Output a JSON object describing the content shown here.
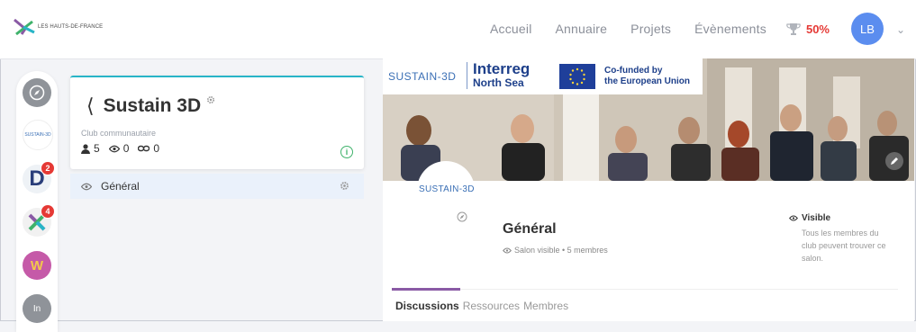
{
  "topbar": {
    "logo_text": "LES HAUTS-DE-FRANCE",
    "nav": [
      "Accueil",
      "Annuaire",
      "Projets",
      "Évènements"
    ],
    "trophy_pct": "50%",
    "avatar_initials": "LB"
  },
  "rail": {
    "sustain_label": "SUSTAIN-3D",
    "badge_d": "2",
    "badge_x": "4",
    "in_label": "In"
  },
  "club": {
    "name": "Sustain 3D",
    "type": "Club communautaire",
    "members": "5",
    "views": "0",
    "links": "0"
  },
  "channel": {
    "label": "Général"
  },
  "banner": {
    "sustain": "SUSTAIN-3D",
    "interreg1": "Interreg",
    "interreg2": "North Sea",
    "eu1": "Co-funded by",
    "eu2": "the European Union"
  },
  "room": {
    "profile_name": "SUSTAIN-3D",
    "title": "Général",
    "subtitle": "Salon visible • 5 membres",
    "visible_title": "Visible",
    "visible_desc": "Tous les membres du club peuvent trouver ce salon."
  },
  "tabs": [
    "Discussions",
    "Ressources",
    "Membres"
  ],
  "colors": {
    "accent": "#28b5c7",
    "badge": "#e53935",
    "avatar": "#5b8def",
    "tab_indicator": "#8a5aa5"
  }
}
